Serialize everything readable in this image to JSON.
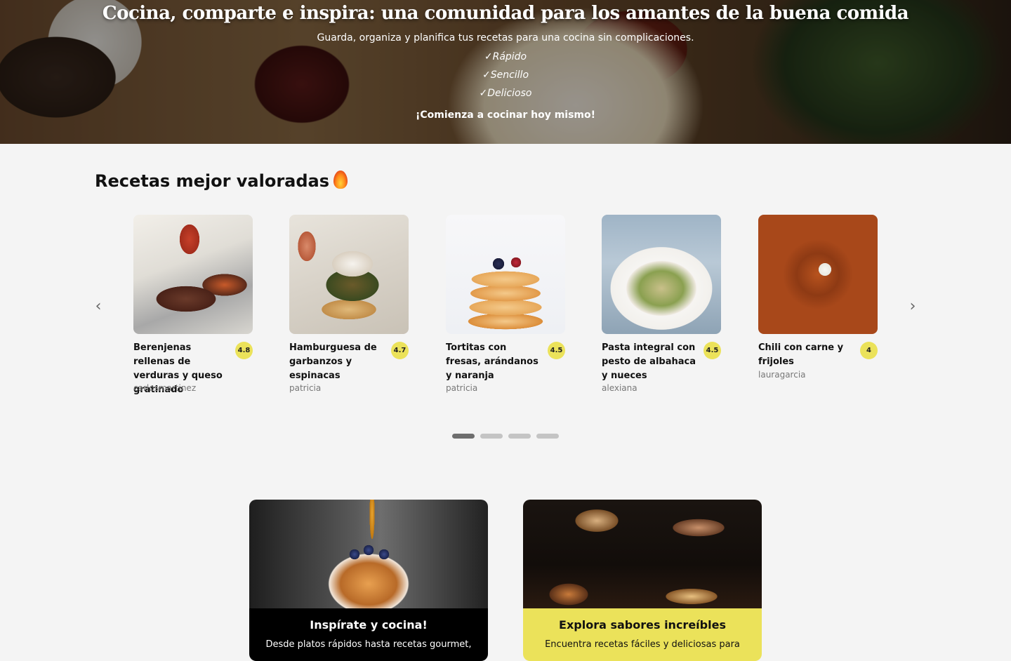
{
  "hero": {
    "title": "Cocina, comparte e inspira: una comunidad para los amantes de la buena comida",
    "subtitle": "Guarda, organiza y planifica tus recetas para una cocina sin complicaciones.",
    "features": [
      "✓Rápido",
      "✓Sencillo",
      "✓Delicioso"
    ],
    "cta": "¡Comienza a cocinar hoy mismo!"
  },
  "top_rated": {
    "title": "Recetas mejor valoradas",
    "icon": "flame-icon",
    "prev_icon": "chevron-left-icon",
    "next_icon": "chevron-right-icon",
    "prev_symbol": "‹",
    "next_symbol": "›",
    "recipes": [
      {
        "name": "Berenjenas rellenas de verduras y queso gratinado",
        "rating": "4.8",
        "author": "carlosmartinez"
      },
      {
        "name": "Hamburguesa de garbanzos y espinacas",
        "rating": "4.7",
        "author": "patricia"
      },
      {
        "name": "Tortitas con fresas, arándanos y naranja",
        "rating": "4.5",
        "author": "patricia"
      },
      {
        "name": "Pasta integral con pesto de albahaca y nueces",
        "rating": "4.5",
        "author": "alexiana"
      },
      {
        "name": "Chili con carne y frijoles",
        "rating": "4",
        "author": "lauragarcia"
      }
    ],
    "pagination": {
      "pages": 4,
      "active": 1
    }
  },
  "promos": [
    {
      "title": "Inspírate y cocina!",
      "text": "Desde platos rápidos hasta recetas gourmet,",
      "background": "#000000"
    },
    {
      "title": "Explora sabores increíbles",
      "text": "Encuentra recetas fáciles y deliciosas para",
      "background": "#ebe25a"
    }
  ],
  "colors": {
    "accent": "#ebe25a",
    "page_bg": "#f4f4f4",
    "dot_active": "#6e6e6e",
    "dot_inactive": "#c4c4c4"
  }
}
